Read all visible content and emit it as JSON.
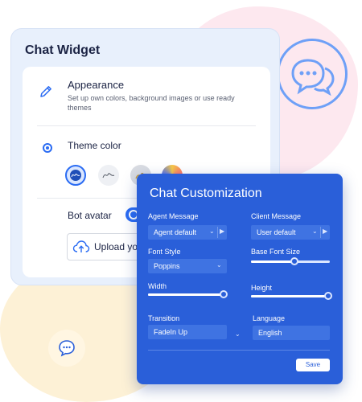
{
  "widget": {
    "title": "Chat Widget",
    "appearance": {
      "title": "Appearance",
      "description": "Set up own colors, background images or use ready themes"
    },
    "theme_color_label": "Theme color",
    "bot_avatar_label": "Bot avatar",
    "upload_label": "Upload your"
  },
  "customization": {
    "title": "Chat Customization",
    "agent_message": {
      "label": "Agent Message",
      "value": "Agent default"
    },
    "client_message": {
      "label": "Client Message",
      "value": "User default"
    },
    "font_style": {
      "label": "Font Style",
      "value": "Poppins"
    },
    "base_font_size": {
      "label": "Base Font Size",
      "level": 0.55
    },
    "width": {
      "label": "Width",
      "level": 0.96
    },
    "height": {
      "label": "Height",
      "level": 0.98
    },
    "transition": {
      "label": "Transition",
      "value": "FadeIn Up"
    },
    "language": {
      "label": "Language",
      "value": "English"
    },
    "save_label": "Save"
  },
  "colors": {
    "accent": "#2b6cf3",
    "panel": "#2a5fd9",
    "card": "#e8f0fc"
  }
}
